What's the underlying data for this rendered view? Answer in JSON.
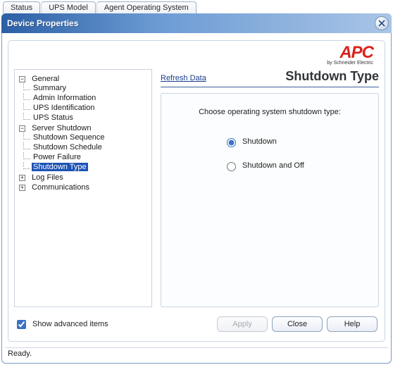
{
  "tabs": {
    "status": "Status",
    "ups_model": "UPS Model",
    "agent_os": "Agent Operating System"
  },
  "titlebar": {
    "title": "Device Properties"
  },
  "logo": {
    "text": "APC",
    "sub": "by Schneider Electric"
  },
  "tree": {
    "general": "General",
    "summary": "Summary",
    "admin_info": "Admin Information",
    "ups_identification": "UPS Identification",
    "ups_status": "UPS Status",
    "server_shutdown": "Server Shutdown",
    "shutdown_sequence": "Shutdown Sequence",
    "shutdown_schedule": "Shutdown Schedule",
    "power_failure": "Power Failure",
    "shutdown_type": "Shutdown Type",
    "log_files": "Log Files",
    "communications": "Communications",
    "minus": "−",
    "plus": "+"
  },
  "right": {
    "refresh": "Refresh Data",
    "heading": "Shutdown Type",
    "prompt": "Choose operating system shutdown type:",
    "opt_shutdown": "Shutdown",
    "opt_shutdown_off": "Shutdown and Off"
  },
  "bottom": {
    "show_advanced": "Show advanced items",
    "apply": "Apply",
    "close": "Close",
    "help": "Help"
  },
  "status": {
    "ready": "Ready."
  }
}
